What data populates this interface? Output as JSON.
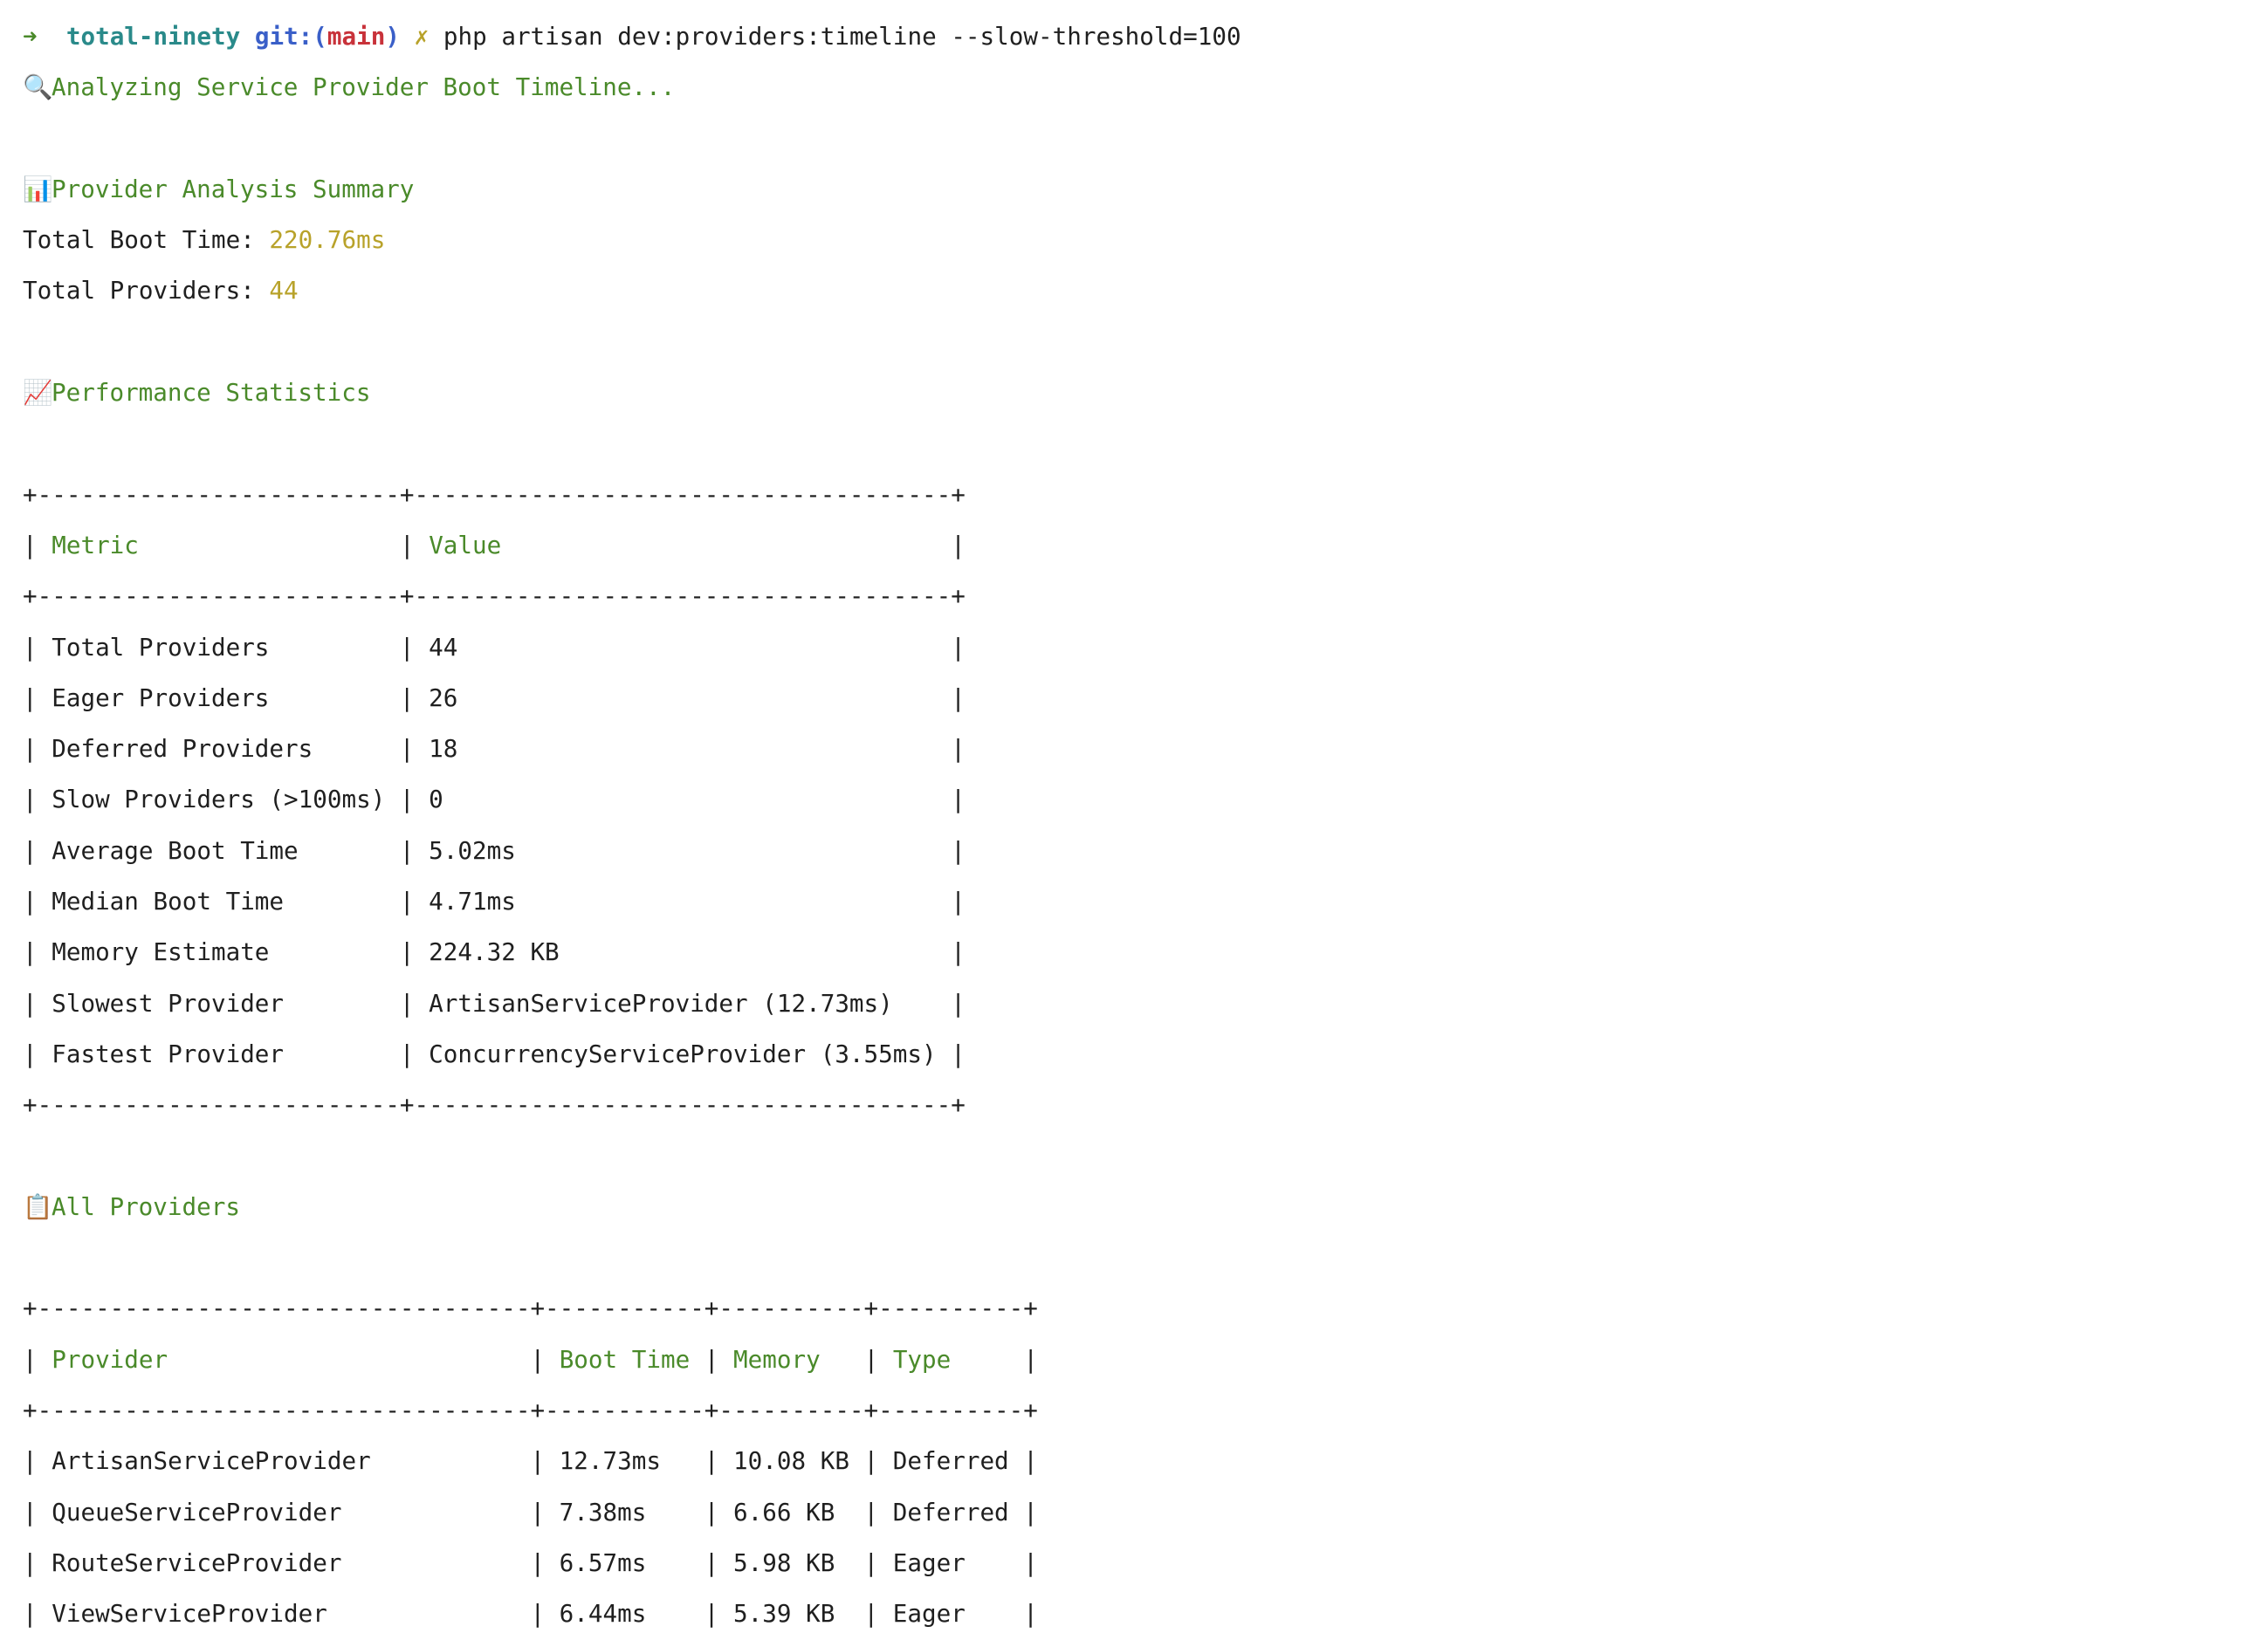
{
  "prompt": {
    "arrow": "➜",
    "dir": "total-ninety",
    "git_label": "git:(",
    "branch": "main",
    "git_close": ")",
    "dirty_mark": "✗",
    "command": "php artisan dev:providers:timeline --slow-threshold=100"
  },
  "analyzing": {
    "icon": "🔍",
    "text": "Analyzing Service Provider Boot Timeline..."
  },
  "summary": {
    "icon": "📊",
    "title": "Provider Analysis Summary",
    "boot_label": "Total Boot Time: ",
    "boot_value": "220.76ms",
    "providers_label": "Total Providers: ",
    "providers_value": "44"
  },
  "stats": {
    "icon": "📈",
    "title": "Performance Statistics",
    "border": "+-------------------------+-------------------------------------+",
    "header": {
      "pipe1": "| ",
      "c1": "Metric",
      "pad1": "                  | ",
      "c2": "Value",
      "pad2": "                               |"
    },
    "rows": [
      "| Total Providers         | 44                                  |",
      "| Eager Providers         | 26                                  |",
      "| Deferred Providers      | 18                                  |",
      "| Slow Providers (>100ms) | 0                                   |",
      "| Average Boot Time       | 5.02ms                              |",
      "| Median Boot Time        | 4.71ms                              |",
      "| Memory Estimate         | 224.32 KB                           |",
      "| Slowest Provider        | ArtisanServiceProvider (12.73ms)    |",
      "| Fastest Provider        | ConcurrencyServiceProvider (3.55ms) |"
    ]
  },
  "providers": {
    "icon": "📋",
    "title": "All Providers",
    "border": "+----------------------------------+-----------+----------+----------+",
    "header": {
      "pipe1": "| ",
      "c1": "Provider",
      "pad1": "                         | ",
      "c2": "Boot Time",
      "pad2": " | ",
      "c3": "Memory",
      "pad3": "   | ",
      "c4": "Type",
      "pad4": "     |"
    },
    "rows": [
      "| ArtisanServiceProvider           | 12.73ms   | 10.08 KB | Deferred |",
      "| QueueServiceProvider             | 7.38ms    | 6.66 KB  | Deferred |",
      "| RouteServiceProvider             | 6.57ms    | 5.98 KB  | Eager    |",
      "| ViewServiceProvider              | 6.44ms    | 5.39 KB  | Eager    |"
    ]
  }
}
